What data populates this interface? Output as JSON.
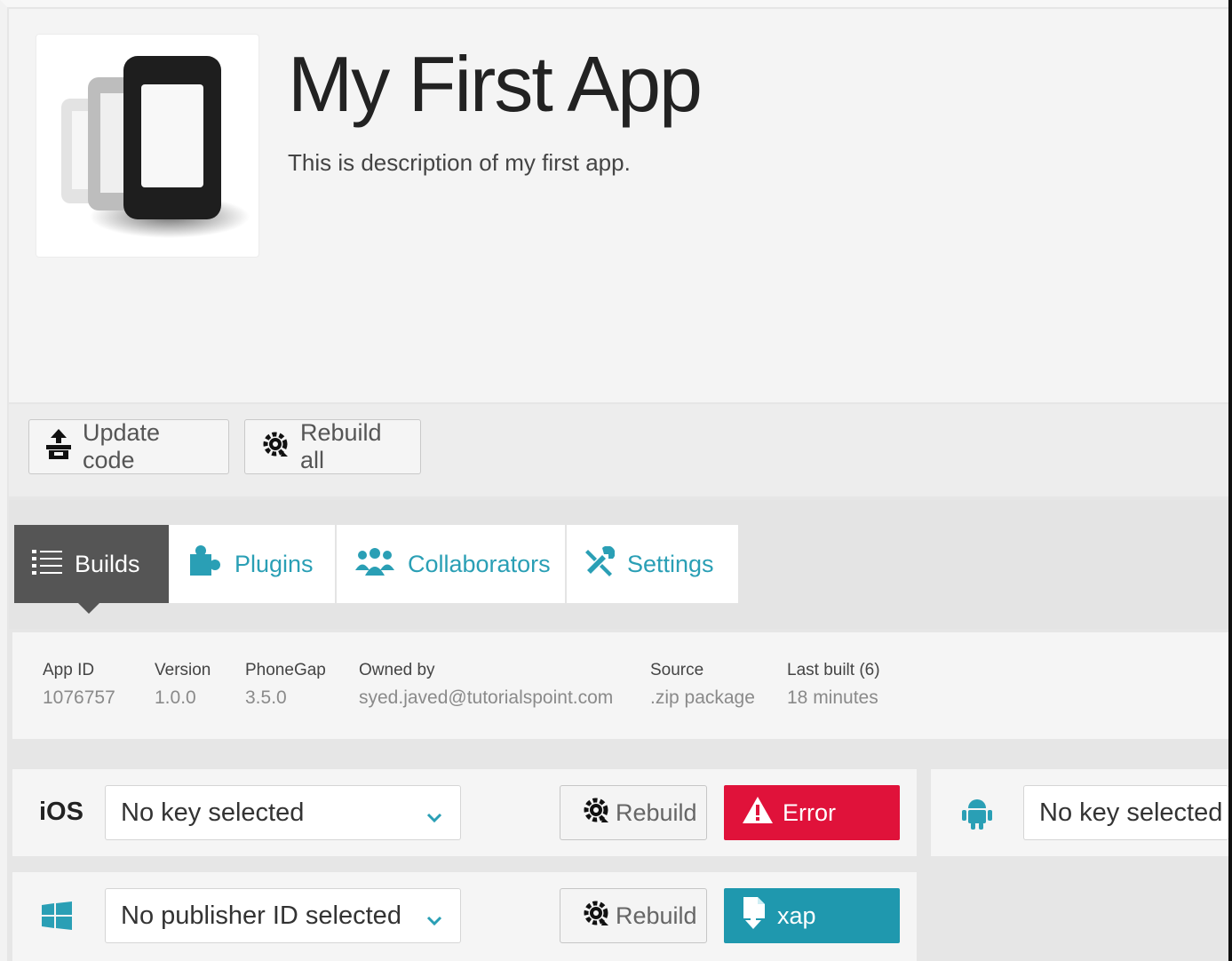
{
  "app": {
    "title": "My First App",
    "description": "This is description of my first app."
  },
  "actions": {
    "update_code": "Update code",
    "rebuild_all": "Rebuild all"
  },
  "tabs": [
    {
      "label": "Builds",
      "icon": "list-icon",
      "active": true
    },
    {
      "label": "Plugins",
      "icon": "puzzle-icon",
      "active": false
    },
    {
      "label": "Collaborators",
      "icon": "people-icon",
      "active": false
    },
    {
      "label": "Settings",
      "icon": "wrench-icon",
      "active": false
    }
  ],
  "info": [
    {
      "label": "App ID",
      "value": "1076757"
    },
    {
      "label": "Version",
      "value": "1.0.0"
    },
    {
      "label": "PhoneGap",
      "value": "3.5.0"
    },
    {
      "label": "Owned by",
      "value": "syed.javed@tutorialspoint.com"
    },
    {
      "label": "Source",
      "value": ".zip package"
    },
    {
      "label": "Last built (6)",
      "value": "18 minutes"
    }
  ],
  "platforms": {
    "ios": {
      "name": "iOS",
      "key_select": "No key selected",
      "rebuild_label": "Rebuild",
      "status_label": "Error",
      "status_color": "#e0123a"
    },
    "android": {
      "icon": "android-icon",
      "key_select": "No key selected"
    },
    "windows": {
      "icon": "windows-icon",
      "key_select": "No publisher ID selected",
      "rebuild_label": "Rebuild",
      "status_label": "xap",
      "status_color": "#1f98ae"
    }
  },
  "colors": {
    "accent": "#2a9fb5",
    "active_tab": "#555555",
    "error": "#e0123a",
    "download": "#1f98ae"
  }
}
